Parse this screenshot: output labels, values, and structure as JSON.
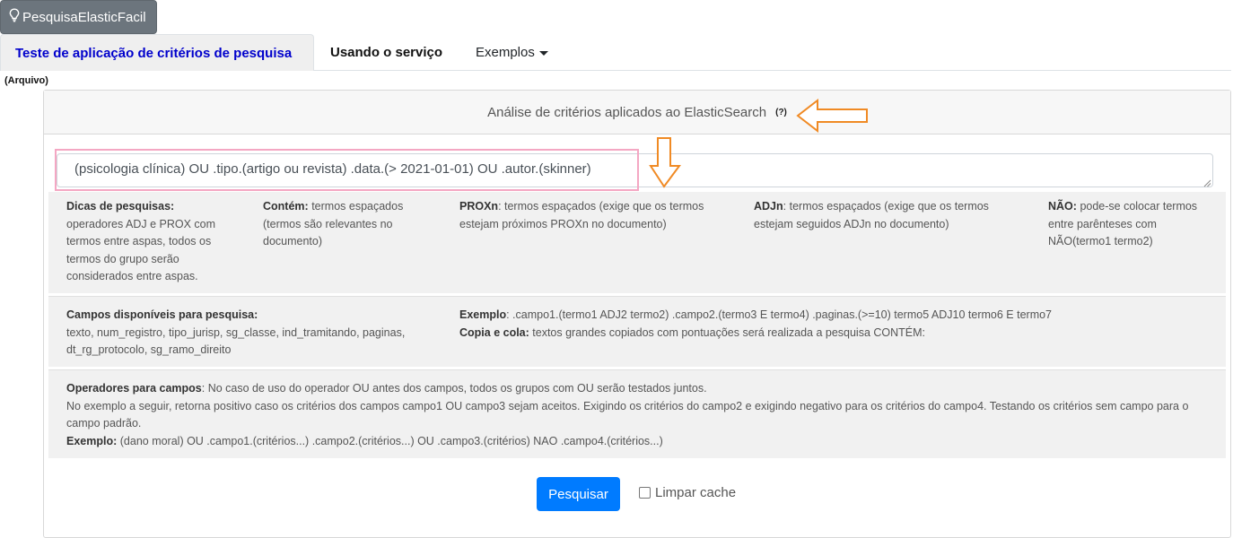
{
  "brand": {
    "icon": "lightbulb-icon",
    "label": "PesquisaElasticFacil"
  },
  "nav": {
    "tabs": [
      {
        "label": "Teste de aplicação de critérios de pesquisa",
        "active": true
      },
      {
        "label": "Usando o serviço",
        "active": false
      },
      {
        "label": "Exemplos",
        "active": false,
        "dropdown": true
      }
    ]
  },
  "arquivo_label": "(Arquivo)",
  "card": {
    "header_title": "Análise de critérios aplicados ao ElasticSearch",
    "help_link": "(?)"
  },
  "query": {
    "value": "(psicologia clínica) OU .tipo.(artigo ou revista) .data.(> 2021-01-01) OU .autor.(skinner)"
  },
  "tips_row1": {
    "dicas_title": "Dicas de pesquisas:",
    "dicas_text": "operadores ADJ e PROX com termos entre aspas, todos os termos do grupo serão considerados entre aspas.",
    "contem_title": "Contém:",
    "contem_text": "termos espaçados (termos são relevantes no documento)",
    "proxn_title": "PROXn",
    "proxn_text": ": termos espaçados (exige que os termos estejam próximos PROXn no documento)",
    "adjn_title": "ADJn",
    "adjn_text": ": termos espaçados (exige que os termos estejam seguidos ADJn no documento)",
    "nao_title": "NÃO:",
    "nao_text": "pode-se colocar termos entre parênteses com NÃO(termo1 termo2)"
  },
  "tips_row2": {
    "campos_title": "Campos disponíveis para pesquisa:",
    "campos_text": "texto, num_registro, tipo_jurisp, sg_classe, ind_tramitando, paginas, dt_rg_protocolo, sg_ramo_direito",
    "exemplo_title": "Exemplo",
    "exemplo_text": ": .campo1.(termo1 ADJ2 termo2) .campo2.(termo3 E termo4) .paginas.(>=10) termo5 ADJ10 termo6 E termo7",
    "copia_title": "Copia e cola:",
    "copia_text": "textos grandes copiados com pontuações será realizada a pesquisa CONTÉM:"
  },
  "tips_row3": {
    "operadores_title": "Operadores para campos",
    "operadores_text": ": No caso de uso do operador OU antes dos campos, todos os grupos com OU serão testados juntos.",
    "line2": "No exemplo a seguir, retorna positivo caso os critérios dos campos campo1 OU campo3 sejam aceitos. Exigindo os critérios do campo2 e exigindo negativo para os critérios do campo4. Testando os critérios sem campo para o campo padrão.",
    "exemplo_title": "Exemplo:",
    "exemplo_text": "(dano moral) OU .campo1.(critérios...) .campo2.(critérios...) OU .campo3.(critérios) NAO .campo4.(critérios...)"
  },
  "actions": {
    "search_button": "Pesquisar",
    "clear_cache_label": "Limpar cache",
    "clear_cache_checked": false
  },
  "annotation_colors": {
    "arrow": "#f08a24",
    "highlight": "#f4a7c3",
    "primary": "#007bff"
  }
}
